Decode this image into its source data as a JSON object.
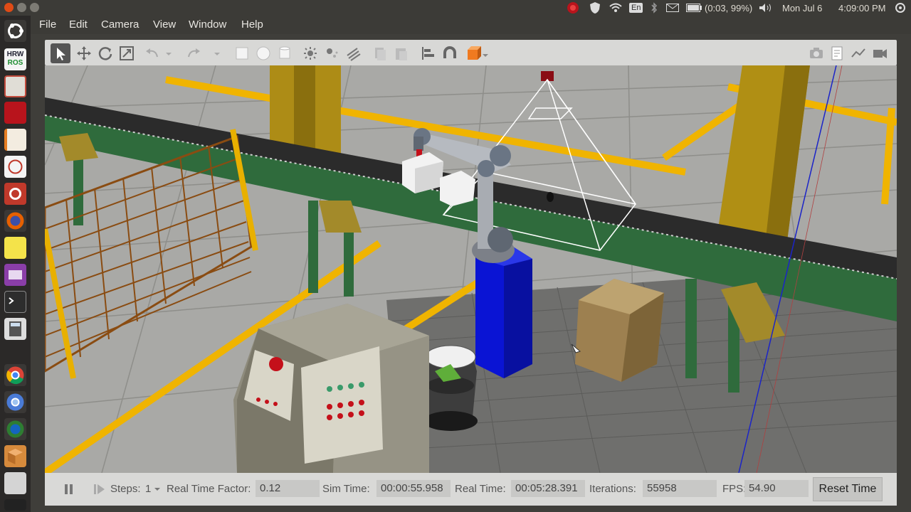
{
  "system": {
    "keyboard_layout": "En",
    "battery": "(0:03, 99%)",
    "date": "Mon Jul 6",
    "time": "4:09:00 PM"
  },
  "launcher": {
    "items": [
      "ubuntu-dash-icon",
      "hrwros-icon",
      "files-icon",
      "terminal-red-icon",
      "text-editor-icon",
      "image-viewer-icon",
      "settings-icon",
      "firefox-icon",
      "notes-icon",
      "window-manager-icon",
      "terminal-icon",
      "calculator-icon",
      "chrome-icon",
      "chromium-icon",
      "gazebo-icon",
      "box-icon",
      "drive-icon",
      "screen-icon"
    ],
    "hrwros_line1": "HRW",
    "hrwros_line2": "ROS"
  },
  "menu": {
    "file": "File",
    "edit": "Edit",
    "camera": "Camera",
    "view": "View",
    "window": "Window",
    "help": "Help"
  },
  "status": {
    "steps_label": "Steps:",
    "steps_value": "1",
    "rtf_label": "Real Time Factor:",
    "rtf_value": "0.12",
    "sim_time_label": "Sim Time:",
    "sim_time_value": "00:00:55.958",
    "real_time_label": "Real Time:",
    "real_time_value": "00:05:28.391",
    "iterations_label": "Iterations:",
    "iterations_value": "55958",
    "fps_label": "FPS:",
    "fps_value": "54.90",
    "reset_label": "Reset Time"
  },
  "colors": {
    "accent": "#e95420",
    "robot_pedestal": "#0a14d4",
    "safety_yellow": "#f0b400",
    "conveyor_green": "#2f6b3c"
  }
}
